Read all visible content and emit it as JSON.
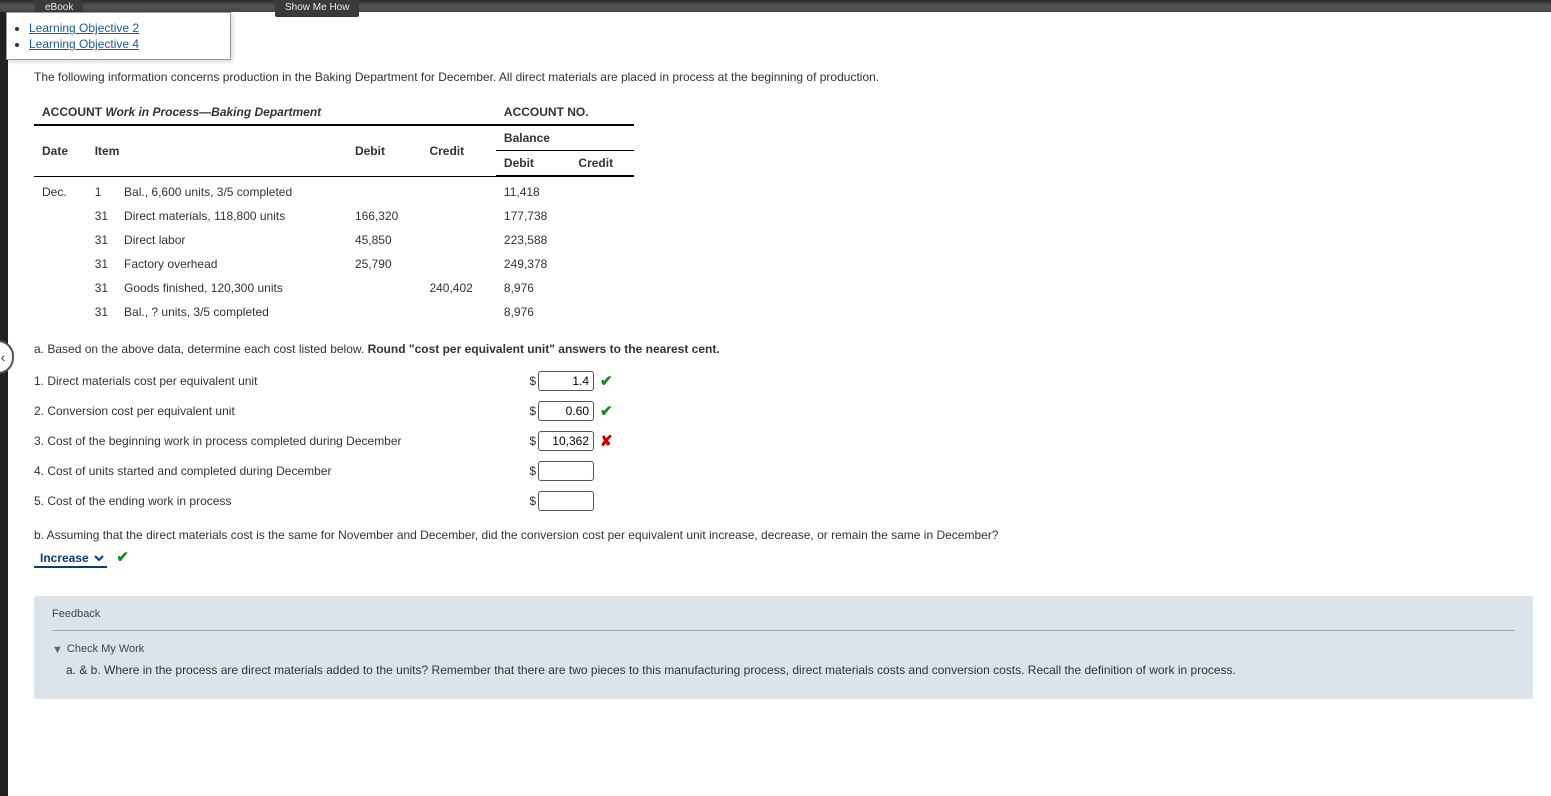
{
  "tabs": {
    "ebook": "eBook",
    "show": "Show Me How"
  },
  "dropdown": {
    "items": [
      {
        "label": "Learning Objective 2"
      },
      {
        "label": "Learning Objective 4"
      }
    ]
  },
  "intro": "The following information concerns production in the Baking Department for December. All direct materials are placed in process at the beginning of production.",
  "ledger": {
    "account_label": "ACCOUNT",
    "account_title": "Work in Process—Baking Department",
    "account_no_label": "ACCOUNT NO.",
    "headers": {
      "date": "Date",
      "item": "Item",
      "debit": "Debit",
      "credit": "Credit",
      "balance": "Balance",
      "bal_debit": "Debit",
      "bal_credit": "Credit"
    },
    "rows": [
      {
        "date": "Dec.",
        "day": "1",
        "item": "Bal., 6,600 units, 3/5 completed",
        "debit": "",
        "credit": "",
        "bal_debit": "11,418",
        "bal_credit": ""
      },
      {
        "date": "",
        "day": "31",
        "item": "Direct materials, 118,800 units",
        "debit": "166,320",
        "credit": "",
        "bal_debit": "177,738",
        "bal_credit": ""
      },
      {
        "date": "",
        "day": "31",
        "item": "Direct labor",
        "debit": "45,850",
        "credit": "",
        "bal_debit": "223,588",
        "bal_credit": ""
      },
      {
        "date": "",
        "day": "31",
        "item": "Factory overhead",
        "debit": "25,790",
        "credit": "",
        "bal_debit": "249,378",
        "bal_credit": ""
      },
      {
        "date": "",
        "day": "31",
        "item": "Goods finished, 120,300 units",
        "debit": "",
        "credit": "240,402",
        "bal_debit": "8,976",
        "bal_credit": ""
      },
      {
        "date": "",
        "day": "31",
        "item": "Bal., ? units, 3/5 completed",
        "debit": "",
        "credit": "",
        "bal_debit": "8,976",
        "bal_credit": ""
      }
    ]
  },
  "part_a": {
    "prompt_prefix": "a.  Based on the above data, determine each cost listed below. ",
    "prompt_bold": "Round \"cost per equivalent unit\" answers to the nearest cent.",
    "items": [
      {
        "label": "1.  Direct materials cost per equivalent unit",
        "value": "1.4",
        "mark": "ok"
      },
      {
        "label": "2.  Conversion cost per equivalent unit",
        "value": "0.60",
        "mark": "ok"
      },
      {
        "label": "3.  Cost of the beginning work in process completed during December",
        "value": "10,362",
        "mark": "bad"
      },
      {
        "label": "4.  Cost of units started and completed during December",
        "value": "",
        "mark": ""
      },
      {
        "label": "5.  Cost of the ending work in process",
        "value": "",
        "mark": ""
      }
    ]
  },
  "part_b": {
    "prompt": "b.  Assuming that the direct materials cost is the same for November and December, did the conversion cost per equivalent unit increase, decrease, or remain the same in December?",
    "selected": "Increase",
    "mark": "ok"
  },
  "feedback": {
    "title": "Feedback",
    "check_label": "Check My Work",
    "body": "a. & b. Where in the process are direct materials added to the units? Remember that there are two pieces to this manufacturing process, direct materials costs and conversion costs. Recall the definition of work in process."
  },
  "side_tab_glyph": "‹"
}
